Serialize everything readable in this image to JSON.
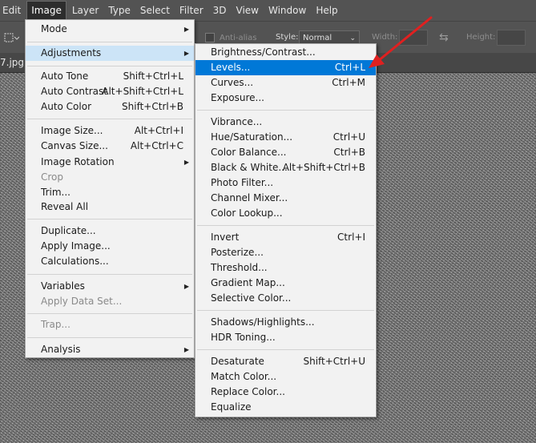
{
  "menubar": {
    "items": [
      "Edit",
      "Image",
      "Layer",
      "Type",
      "Select",
      "Filter",
      "3D",
      "View",
      "Window",
      "Help"
    ]
  },
  "options_bar": {
    "anti_alias_label": "Anti-alias",
    "style_label": "Style:",
    "style_value": "Normal",
    "width_label": "Width:",
    "height_label": "Height:"
  },
  "document": {
    "tab_label": "7.jpg @"
  },
  "image_menu": {
    "items": [
      {
        "label": "Mode",
        "shortcut": "",
        "submenu": true,
        "disabled": false
      },
      {
        "label": "Adjustments",
        "shortcut": "",
        "submenu": true,
        "disabled": false
      },
      {
        "label": "Auto Tone",
        "shortcut": "Shift+Ctrl+L",
        "submenu": false,
        "disabled": false
      },
      {
        "label": "Auto Contrast",
        "shortcut": "Alt+Shift+Ctrl+L",
        "submenu": false,
        "disabled": false
      },
      {
        "label": "Auto Color",
        "shortcut": "Shift+Ctrl+B",
        "submenu": false,
        "disabled": false
      },
      {
        "label": "Image Size...",
        "shortcut": "Alt+Ctrl+I",
        "submenu": false,
        "disabled": false
      },
      {
        "label": "Canvas Size...",
        "shortcut": "Alt+Ctrl+C",
        "submenu": false,
        "disabled": false
      },
      {
        "label": "Image Rotation",
        "shortcut": "",
        "submenu": true,
        "disabled": false
      },
      {
        "label": "Crop",
        "shortcut": "",
        "submenu": false,
        "disabled": true
      },
      {
        "label": "Trim...",
        "shortcut": "",
        "submenu": false,
        "disabled": false
      },
      {
        "label": "Reveal All",
        "shortcut": "",
        "submenu": false,
        "disabled": false
      },
      {
        "label": "Duplicate...",
        "shortcut": "",
        "submenu": false,
        "disabled": false
      },
      {
        "label": "Apply Image...",
        "shortcut": "",
        "submenu": false,
        "disabled": false
      },
      {
        "label": "Calculations...",
        "shortcut": "",
        "submenu": false,
        "disabled": false
      },
      {
        "label": "Variables",
        "shortcut": "",
        "submenu": true,
        "disabled": false
      },
      {
        "label": "Apply Data Set...",
        "shortcut": "",
        "submenu": false,
        "disabled": true
      },
      {
        "label": "Trap...",
        "shortcut": "",
        "submenu": false,
        "disabled": true
      },
      {
        "label": "Analysis",
        "shortcut": "",
        "submenu": true,
        "disabled": false
      }
    ]
  },
  "adjustments_menu": {
    "items": [
      {
        "label": "Brightness/Contrast...",
        "shortcut": ""
      },
      {
        "label": "Levels...",
        "shortcut": "Ctrl+L"
      },
      {
        "label": "Curves...",
        "shortcut": "Ctrl+M"
      },
      {
        "label": "Exposure...",
        "shortcut": ""
      },
      {
        "label": "Vibrance...",
        "shortcut": ""
      },
      {
        "label": "Hue/Saturation...",
        "shortcut": "Ctrl+U"
      },
      {
        "label": "Color Balance...",
        "shortcut": "Ctrl+B"
      },
      {
        "label": "Black & White...",
        "shortcut": "Alt+Shift+Ctrl+B"
      },
      {
        "label": "Photo Filter...",
        "shortcut": ""
      },
      {
        "label": "Channel Mixer...",
        "shortcut": ""
      },
      {
        "label": "Color Lookup...",
        "shortcut": ""
      },
      {
        "label": "Invert",
        "shortcut": "Ctrl+I"
      },
      {
        "label": "Posterize...",
        "shortcut": ""
      },
      {
        "label": "Threshold...",
        "shortcut": ""
      },
      {
        "label": "Gradient Map...",
        "shortcut": ""
      },
      {
        "label": "Selective Color...",
        "shortcut": ""
      },
      {
        "label": "Shadows/Highlights...",
        "shortcut": ""
      },
      {
        "label": "HDR Toning...",
        "shortcut": ""
      },
      {
        "label": "Desaturate",
        "shortcut": "Shift+Ctrl+U"
      },
      {
        "label": "Match Color...",
        "shortcut": ""
      },
      {
        "label": "Replace Color...",
        "shortcut": ""
      },
      {
        "label": "Equalize",
        "shortcut": ""
      }
    ]
  },
  "colors": {
    "highlight": "#0078d7",
    "annotation_arrow": "#e02020",
    "ui_dark": "#535353"
  }
}
